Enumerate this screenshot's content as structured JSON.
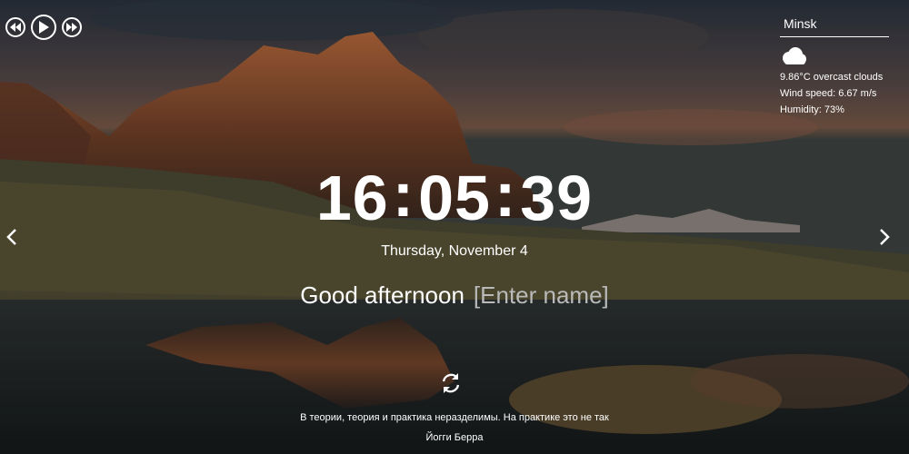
{
  "player": {
    "prev_icon": "rewind-icon",
    "play_icon": "play-icon",
    "next_icon": "fast-forward-icon"
  },
  "weather": {
    "city": "Minsk",
    "icon": "cloud-icon",
    "description": "9.86°C   overcast clouds",
    "wind": "Wind speed: 6.67 m/s",
    "humidity": "Humidity: 73%"
  },
  "clock": {
    "hours": "16",
    "minutes": "05",
    "seconds": "39",
    "separator": ":"
  },
  "date": "Thursday, November 4",
  "greeting": {
    "text": "Good afternoon",
    "name_placeholder": "[Enter name]"
  },
  "quote": {
    "text": "В теории, теория и практика неразделимы. На практике это не так",
    "author": "Йогги Берра"
  },
  "colors": {
    "text": "#ffffff",
    "placeholder": "#b9b9b9"
  }
}
